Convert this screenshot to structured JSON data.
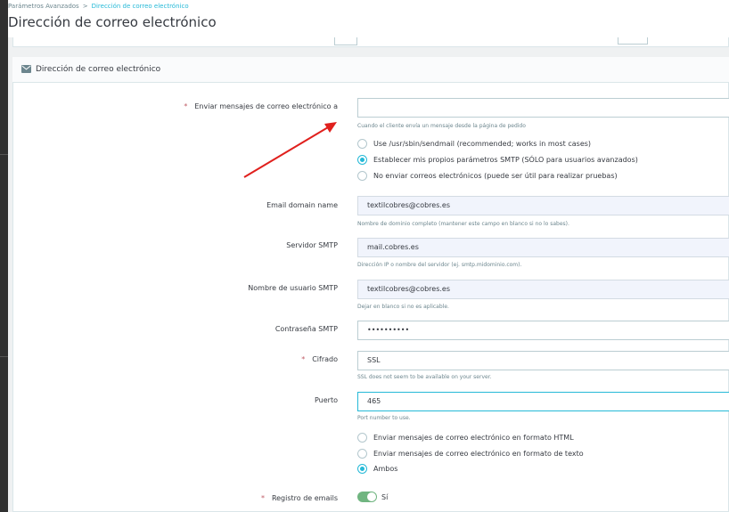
{
  "breadcrumb": {
    "parent": "Parámetros Avanzados",
    "separator": ">",
    "current": "Dirección de correo electrónico"
  },
  "page_title": "Dirección de correo electrónico",
  "card": {
    "title": "Dirección de correo electrónico",
    "icon": "envelope-icon"
  },
  "colors": {
    "accent": "#25b9d7",
    "required": "#c05c67",
    "switch_on": "#70b580",
    "annotation_arrow": "#e0201d"
  },
  "form": {
    "send_to": {
      "label": "Enviar mensajes de correo electrónico a",
      "value": "",
      "help": "Cuando el cliente envía un mensaje desde la página de pedido"
    },
    "method_options": [
      {
        "label": "Use /usr/sbin/sendmail (recommended; works in most cases)",
        "checked": false
      },
      {
        "label": "Establecer mis propios parámetros SMTP (SÓLO para usuarios avanzados)",
        "checked": true
      },
      {
        "label": "No enviar correos electrónicos (puede ser útil para realizar pruebas)",
        "checked": false
      }
    ],
    "domain": {
      "label": "Email domain name",
      "value": "textilcobres@cobres.es",
      "help": "Nombre de dominio completo (mantener este campo en blanco si no lo sabes)."
    },
    "smtp_server": {
      "label": "Servidor SMTP",
      "value": "mail.cobres.es",
      "help": "Dirección IP o nombre del servidor (ej. smtp.midominio.com)."
    },
    "smtp_user": {
      "label": "Nombre de usuario SMTP",
      "value": "textilcobres@cobres.es",
      "help": "Dejar en blanco si no es aplicable."
    },
    "smtp_password": {
      "label": "Contraseña SMTP",
      "value": "••••••••••"
    },
    "encryption": {
      "label": "Cifrado",
      "value": "SSL",
      "help": "SSL does not seem to be available on your server."
    },
    "port": {
      "label": "Puerto",
      "value": "465",
      "help": "Port number to use."
    },
    "format_options": [
      {
        "label": "Enviar mensajes de correo electrónico en formato HTML",
        "checked": false
      },
      {
        "label": "Enviar mensajes de correo electrónico en formato de texto",
        "checked": false
      },
      {
        "label": "Ambos",
        "checked": true
      }
    ],
    "log": {
      "label": "Registro de emails",
      "value": "Sí",
      "on": true
    }
  }
}
